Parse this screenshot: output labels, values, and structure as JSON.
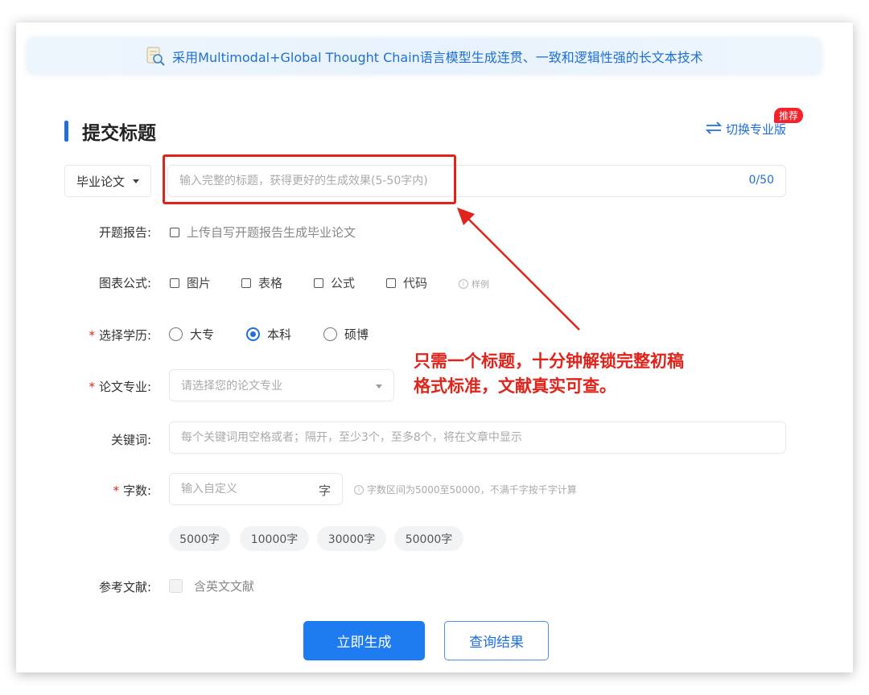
{
  "banner": {
    "text": "采用Multimodal+Global Thought Chain语言模型生成连贯、一致和逻辑性强的长文本技术",
    "icon": "document-search-icon"
  },
  "section": {
    "title": "提交标题"
  },
  "switch": {
    "label": "切换专业版",
    "badge": "推荐",
    "icon": "switch-arrows-icon"
  },
  "paper_type": {
    "selected": "毕业论文"
  },
  "title_input": {
    "placeholder": "输入完整的标题，获得更好的生成效果(5-50字内)",
    "value": "",
    "counter": "0/50"
  },
  "proposal": {
    "label": "开题报告:",
    "option": "上传自写开题报告生成毕业论文"
  },
  "charts": {
    "label": "图表公式:",
    "options": [
      "图片",
      "表格",
      "公式",
      "代码"
    ],
    "example": "样例"
  },
  "education": {
    "label": "选择学历:",
    "required": "*",
    "options": [
      "大专",
      "本科",
      "硕博"
    ],
    "selected": "本科"
  },
  "major": {
    "label": "论文专业:",
    "required": "*",
    "placeholder": "请选择您的论文专业"
  },
  "keywords": {
    "label": "关键词:",
    "placeholder": "每个关键词用空格或者；隔开，至少3个，至多8个，将在文章中显示"
  },
  "word_count": {
    "label": "字数:",
    "required": "*",
    "placeholder": "输入自定义",
    "unit": "字",
    "hint": "字数区间为5000至50000，不满千字按千字计算",
    "presets": [
      "5000字",
      "10000字",
      "30000字",
      "50000字"
    ]
  },
  "references": {
    "label": "参考文献:",
    "option": "含英文文献",
    "checked": false
  },
  "actions": {
    "generate": "立即生成",
    "query": "查询结果"
  },
  "annotation": {
    "line1": "只需一个标题，十分钟解锁完整初稿",
    "line2": "格式标准，文献真实可查。"
  },
  "colors": {
    "accent": "#1f6fe0",
    "annotation_red": "#e0231b",
    "badge_red": "#f5222d"
  }
}
